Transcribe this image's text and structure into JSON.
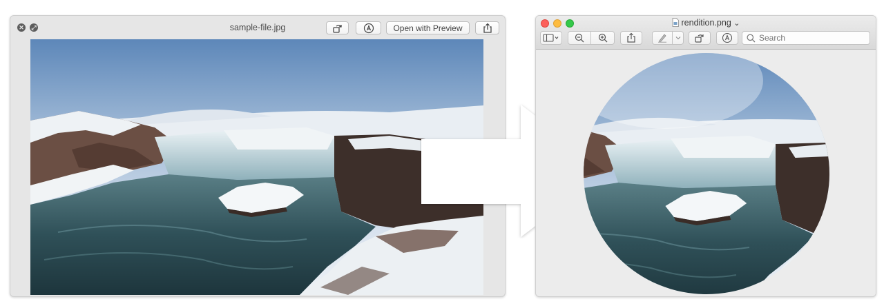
{
  "quicklook": {
    "file_name": "sample-file.jpg",
    "open_button_label": "Open with Preview",
    "close_icon": "close-icon",
    "fullscreen_icon": "fullscreen-icon",
    "rotate_icon": "rotate-icon",
    "markup_icon": "markup-icon",
    "share_icon": "share-icon"
  },
  "preview": {
    "file_name": "rendition.png",
    "title_chevron": "⌄",
    "search": {
      "placeholder": "Search",
      "value": ""
    },
    "toolbar_icons": [
      "sidebar-icon",
      "zoom-out-icon",
      "zoom-in-icon",
      "share-icon",
      "pen-icon",
      "rotate-icon",
      "markup-icon",
      "search-icon"
    ]
  },
  "colors": {
    "traffic_red": "#fc605b",
    "traffic_yellow": "#fdbc40",
    "traffic_green": "#34c84a",
    "window_bg": "#e6e6e6"
  }
}
